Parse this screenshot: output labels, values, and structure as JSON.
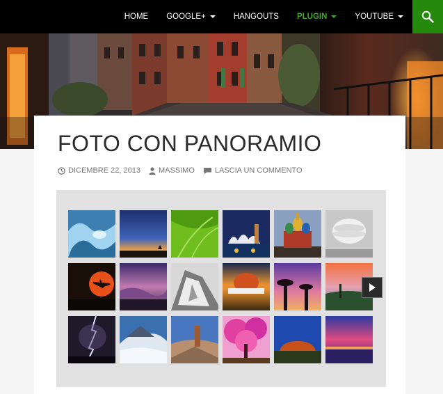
{
  "nav": {
    "items": [
      {
        "label": "HOME",
        "dropdown": false,
        "active": false
      },
      {
        "label": "GOOGLE+",
        "dropdown": true,
        "active": false
      },
      {
        "label": "HANGOUTS",
        "dropdown": false,
        "active": false
      },
      {
        "label": "PLUGIN",
        "dropdown": true,
        "active": true
      },
      {
        "label": "YOUTUBE",
        "dropdown": true,
        "active": false
      }
    ],
    "search_icon": "search-icon",
    "colors": {
      "bar": "#000000",
      "active": "#41a62a",
      "search_bg": "#24890d"
    }
  },
  "post": {
    "title": "FOTO CON PANORAMIO",
    "date": "DICEMBRE 22, 2013",
    "author": "MASSIMO",
    "comment": "LASCIA UN COMMENTO"
  },
  "gallery": {
    "next_icon": "triangle-right-icon"
  }
}
